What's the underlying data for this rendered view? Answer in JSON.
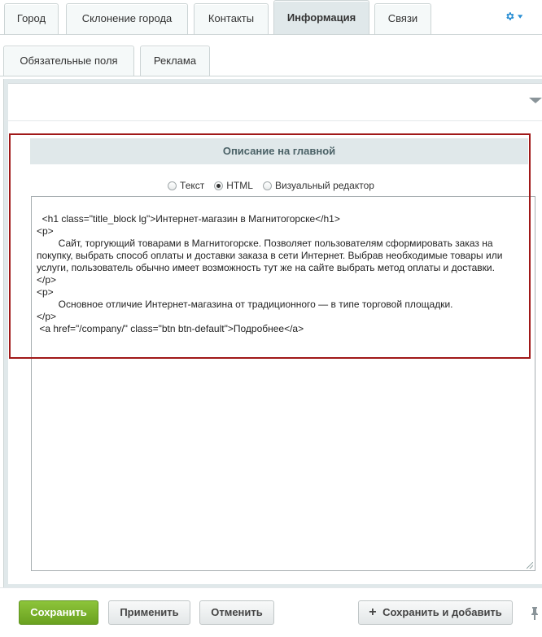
{
  "tabs_row1": [
    {
      "label": "Город",
      "active": false
    },
    {
      "label": "Склонение города",
      "active": false
    },
    {
      "label": "Контакты",
      "active": false
    },
    {
      "label": "Информация",
      "active": true
    },
    {
      "label": "Связи",
      "active": false
    }
  ],
  "tabs_row2": [
    {
      "label": "Обязательные поля",
      "active": false
    },
    {
      "label": "Реклама",
      "active": false
    }
  ],
  "section": {
    "title": "Описание на главной",
    "modes": [
      {
        "label": "Текст",
        "checked": false
      },
      {
        "label": "HTML",
        "checked": true
      },
      {
        "label": "Визуальный редактор",
        "checked": false
      }
    ],
    "content": "<h1 class=\"title_block lg\">Интернет-магазин в Магнитогорске</h1>\n<p>\n\tСайт, торгующий товарами в Магнитогорске. Позволяет пользователям сформировать заказ на покупку, выбрать способ оплаты и доставки заказа в сети Интернет. Выбрав необходимые товары или услуги, пользователь обычно имеет возможность тут же на сайте выбрать метод оплаты и доставки.\n</p>\n<p>\n\tОсновное отличие Интернет-магазина от традиционного — в типе торговой площадки.\n</p>\n <a href=\"/company/\" class=\"btn btn-default\">Подробнее</a>"
  },
  "footer": {
    "save": "Сохранить",
    "apply": "Применить",
    "cancel": "Отменить",
    "save_add": "Сохранить и добавить"
  },
  "colors": {
    "accent": "#2b8fd4",
    "primary_button": "#7cb32d",
    "highlight": "#a01818"
  }
}
